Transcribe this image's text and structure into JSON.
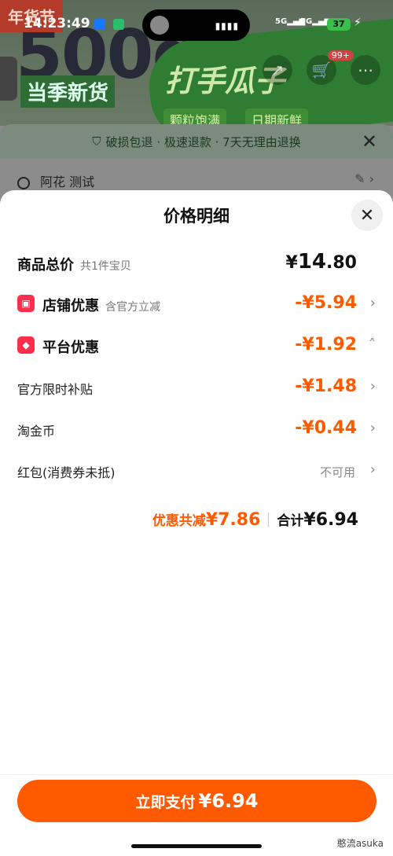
{
  "status": {
    "time": "14:23:49",
    "battery": "37",
    "sim1": "5G",
    "sim2": "5G"
  },
  "background": {
    "badge": "年货节",
    "big_text": "500g",
    "sub_text": "当季新货",
    "title": "打手瓜子",
    "chip1": "颗粒饱满",
    "chip2": "日期新鲜",
    "cart_badge": "99+",
    "notice": "破损包退 · 极速退款 · 7天无理由退换",
    "address": "阿花 测试"
  },
  "sheet": {
    "title": "价格明细",
    "rows": {
      "total": {
        "label": "商品总价",
        "sub": "共1件宝贝",
        "amount_prefix": "¥",
        "amount_int": "14",
        "amount_dec": ".80"
      },
      "store": {
        "icon": "store-coupon-icon",
        "label": "店铺优惠",
        "sub": "含官方立减",
        "amount": "-¥5.94"
      },
      "platform": {
        "icon": "platform-coupon-icon",
        "label": "平台优惠",
        "amount": "-¥1.92"
      },
      "subsidy": {
        "label": "官方限时补贴",
        "amount": "-¥1.48"
      },
      "coin": {
        "label": "淘金币",
        "amount": "-¥0.44"
      },
      "redpack": {
        "label": "红包(消费券未抵)",
        "status": "不可用"
      }
    },
    "summary": {
      "save_label": "优惠共减",
      "save_amount": "¥7.86",
      "total_label": "合计",
      "total_amount": "¥6.94"
    },
    "pay_button": {
      "label": "立即支付",
      "amount": "¥6.94"
    }
  },
  "watermark": "憨流asuka",
  "colors": {
    "accent": "#ff5a00",
    "coupon_icon": "#ff2e4d"
  }
}
